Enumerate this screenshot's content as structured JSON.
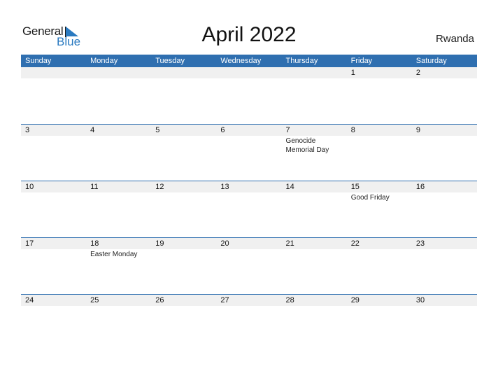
{
  "logo": {
    "text_general": "General",
    "text_blue": "Blue",
    "icon": "triangle-flag-icon"
  },
  "title": "April 2022",
  "country": "Rwanda",
  "colors": {
    "header_bg": "#2f6fb0",
    "band_bg": "#f0f0f0",
    "logo_blue": "#2a7ac0"
  },
  "weekdays": [
    "Sunday",
    "Monday",
    "Tuesday",
    "Wednesday",
    "Thursday",
    "Friday",
    "Saturday"
  ],
  "weeks": [
    [
      {
        "day": ""
      },
      {
        "day": ""
      },
      {
        "day": ""
      },
      {
        "day": ""
      },
      {
        "day": ""
      },
      {
        "day": "1"
      },
      {
        "day": "2"
      }
    ],
    [
      {
        "day": "3"
      },
      {
        "day": "4"
      },
      {
        "day": "5"
      },
      {
        "day": "6"
      },
      {
        "day": "7",
        "event": "Genocide Memorial Day"
      },
      {
        "day": "8"
      },
      {
        "day": "9"
      }
    ],
    [
      {
        "day": "10"
      },
      {
        "day": "11"
      },
      {
        "day": "12"
      },
      {
        "day": "13"
      },
      {
        "day": "14"
      },
      {
        "day": "15",
        "event": "Good Friday"
      },
      {
        "day": "16"
      }
    ],
    [
      {
        "day": "17"
      },
      {
        "day": "18",
        "event": "Easter Monday"
      },
      {
        "day": "19"
      },
      {
        "day": "20"
      },
      {
        "day": "21"
      },
      {
        "day": "22"
      },
      {
        "day": "23"
      }
    ],
    [
      {
        "day": "24"
      },
      {
        "day": "25"
      },
      {
        "day": "26"
      },
      {
        "day": "27"
      },
      {
        "day": "28"
      },
      {
        "day": "29"
      },
      {
        "day": "30"
      }
    ]
  ]
}
